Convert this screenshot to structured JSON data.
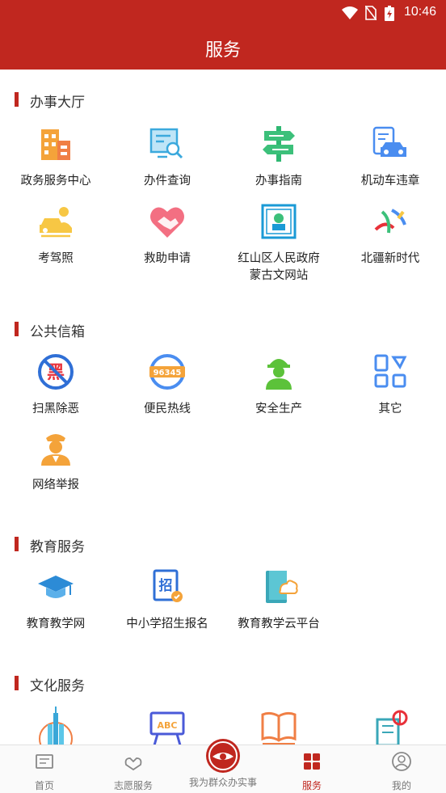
{
  "status_bar": {
    "time": "10:46"
  },
  "header": {
    "title": "服务"
  },
  "sections": [
    {
      "title": "办事大厅",
      "items": [
        {
          "label": "政务服务中心",
          "icon": "government-building-icon"
        },
        {
          "label": "办件查询",
          "icon": "document-search-icon"
        },
        {
          "label": "办事指南",
          "icon": "signpost-icon"
        },
        {
          "label": "机动车违章",
          "icon": "car-violation-icon"
        },
        {
          "label": "考驾照",
          "icon": "driving-license-icon"
        },
        {
          "label": "救助申请",
          "icon": "heart-handshake-icon"
        },
        {
          "label": "红山区人民政府\n蒙古文网站",
          "icon": "mongolian-website-icon"
        },
        {
          "label": "北疆新时代",
          "icon": "beijiang-logo-icon"
        }
      ]
    },
    {
      "title": "公共信箱",
      "items": [
        {
          "label": "扫黑除恶",
          "icon": "anti-crime-icon",
          "badge": "黑"
        },
        {
          "label": "便民热线",
          "icon": "hotline-icon",
          "badge": "96345"
        },
        {
          "label": "安全生产",
          "icon": "safety-worker-icon"
        },
        {
          "label": "其它",
          "icon": "grid-shapes-icon"
        },
        {
          "label": "网络举报",
          "icon": "police-officer-icon"
        }
      ]
    },
    {
      "title": "教育服务",
      "items": [
        {
          "label": "教育教学网",
          "icon": "graduation-cap-icon"
        },
        {
          "label": "中小学招生报名",
          "icon": "enrollment-icon",
          "badge": "招"
        },
        {
          "label": "教育教学云平台",
          "icon": "cloud-book-icon"
        }
      ]
    },
    {
      "title": "文化服务",
      "items": [
        {
          "label": "",
          "icon": "city-tower-icon"
        },
        {
          "label": "",
          "icon": "abc-board-icon",
          "badge": "ABC"
        },
        {
          "label": "",
          "icon": "open-book-icon"
        },
        {
          "label": "",
          "icon": "library-building-icon"
        }
      ]
    }
  ],
  "tabbar": {
    "tabs": [
      {
        "label": "首页",
        "icon": "home-news-icon",
        "active": false
      },
      {
        "label": "志愿服务",
        "icon": "volunteer-hands-icon",
        "active": false
      },
      {
        "label": "我为群众办实事",
        "icon": "center-emblem-icon",
        "active": false
      },
      {
        "label": "服务",
        "icon": "service-grid-icon",
        "active": true
      },
      {
        "label": "我的",
        "icon": "profile-icon",
        "active": false
      }
    ]
  },
  "colors": {
    "primary": "#c0271f",
    "orange": "#f4a33a",
    "blue": "#4a8df0",
    "green": "#3cc07a"
  }
}
